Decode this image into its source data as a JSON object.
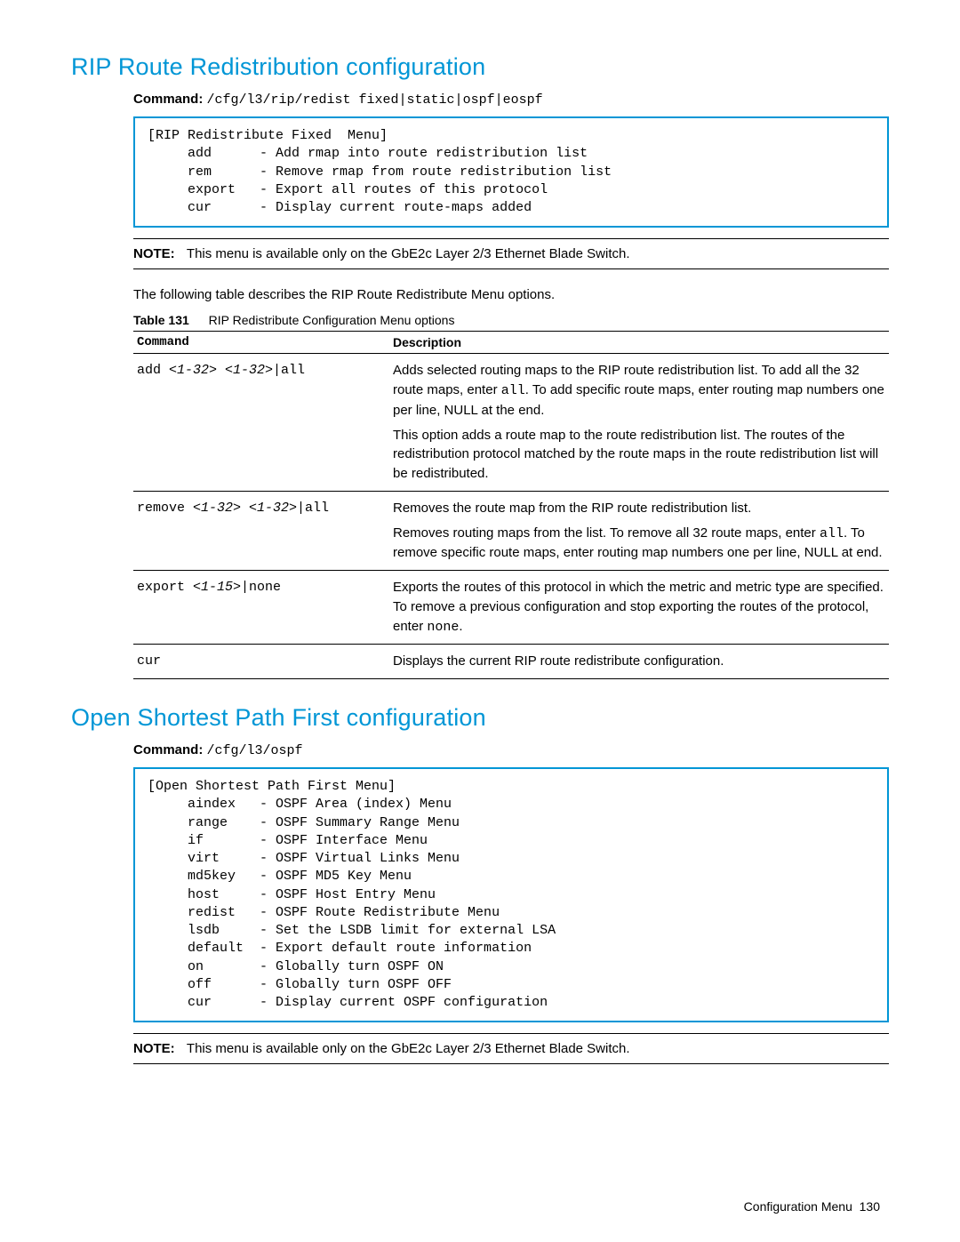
{
  "sections": {
    "rip": {
      "title": "RIP Route Redistribution configuration",
      "command_label": "Command:",
      "command": "/cfg/l3/rip/redist fixed|static|ospf|eospf",
      "menu": "[RIP Redistribute Fixed  Menu]\n     add      - Add rmap into route redistribution list\n     rem      - Remove rmap from route redistribution list\n     export   - Export all routes of this protocol\n     cur      - Display current route-maps added",
      "note_label": "NOTE:",
      "note_text": "This menu is available only on the GbE2c Layer 2/3 Ethernet Blade Switch.",
      "para": "The following table describes the RIP Route Redistribute Menu options.",
      "table_label": "Table 131",
      "table_caption": "RIP Redistribute Configuration Menu options",
      "headers": {
        "cmd": "Command",
        "desc": "Description"
      }
    },
    "ospf": {
      "title": "Open Shortest Path First configuration",
      "command_label": "Command:",
      "command": "/cfg/l3/ospf",
      "menu": "[Open Shortest Path First Menu]\n     aindex   - OSPF Area (index) Menu\n     range    - OSPF Summary Range Menu\n     if       - OSPF Interface Menu\n     virt     - OSPF Virtual Links Menu\n     md5key   - OSPF MD5 Key Menu\n     host     - OSPF Host Entry Menu\n     redist   - OSPF Route Redistribute Menu\n     lsdb     - Set the LSDB limit for external LSA\n     default  - Export default route information\n     on       - Globally turn OSPF ON\n     off      - Globally turn OSPF OFF\n     cur      - Display current OSPF configuration",
      "note_label": "NOTE:",
      "note_text": "This menu is available only on the GbE2c Layer 2/3 Ethernet Blade Switch."
    }
  },
  "table_rows": {
    "r0": {
      "cmd_html": "add <i>&lt;1-32&gt; &lt;1-32&gt;</i>|all",
      "desc_html": "<div class='desc-block'>Adds selected routing maps to the RIP route redistribution list. To add all the 32 route maps, enter <span class='mono'>all</span>. To add specific route maps, enter routing map numbers one per line, NULL at the end.</div><div class='desc-block'>This option adds a route map to the route redistribution list. The routes of the redistribution protocol matched by the route maps in the route redistribution list will be redistributed.</div>"
    },
    "r1": {
      "cmd_html": "remove <i>&lt;1-32&gt; &lt;1-32&gt;</i>|all",
      "desc_html": "<div class='desc-block'>Removes the route map from the RIP route redistribution list.</div><div class='desc-block'>Removes routing maps from the list. To remove all 32 route maps, enter <span class='mono'>all</span>. To remove specific route maps, enter routing map numbers one per line, NULL at end.</div>"
    },
    "r2": {
      "cmd_html": "export <i>&lt;1-15&gt;</i>|none",
      "desc_html": "Exports the routes of this protocol in which the metric and metric type are specified. To remove a previous configuration and stop exporting the routes of the protocol, enter <span class='mono'>none</span>."
    },
    "r3": {
      "cmd_html": "cur",
      "desc_html": "Displays the current RIP route redistribute configuration."
    }
  },
  "footer": {
    "section": "Configuration Menu",
    "page": "130"
  }
}
